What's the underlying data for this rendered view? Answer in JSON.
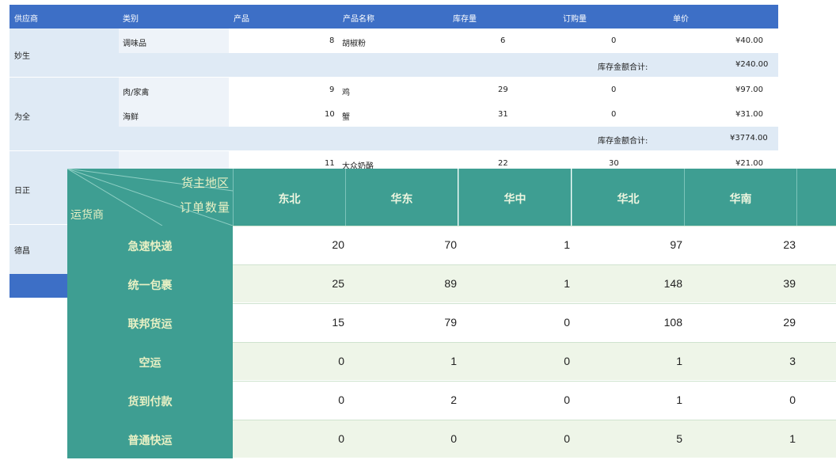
{
  "back_table": {
    "headers": [
      "供应商",
      "类别",
      "产品",
      "产品名称",
      "库存量",
      "订购量",
      "单价"
    ],
    "suppliers": [
      "妙生",
      "为全",
      "日正",
      "德昌"
    ],
    "rows": [
      {
        "category": "调味品",
        "product_id": "8",
        "name": "胡椒粉",
        "stock": "6",
        "order": "0",
        "price": "¥40.00"
      },
      {
        "category": "肉/家禽",
        "product_id": "9",
        "name": "鸡",
        "stock": "29",
        "order": "0",
        "price": "¥97.00"
      },
      {
        "category": "海鲜",
        "product_id": "10",
        "name": "蟹",
        "stock": "31",
        "order": "0",
        "price": "¥31.00"
      },
      {
        "category": "",
        "product_id": "11",
        "name": "大众奶酪",
        "stock": "22",
        "order": "30",
        "price": "¥21.00"
      }
    ],
    "subtotals": [
      {
        "label": "库存金额合计:",
        "value": "¥240.00"
      },
      {
        "label": "库存金额合计:",
        "value": "¥3774.00"
      }
    ]
  },
  "front_table": {
    "corner": {
      "region_label": "货主地区",
      "orders_label": "订单数量",
      "carrier_label": "运货商"
    },
    "regions": [
      "东北",
      "华东",
      "华中",
      "华北",
      "华南"
    ],
    "rows": [
      {
        "carrier": "急速快递",
        "values": [
          "20",
          "70",
          "1",
          "97",
          "23"
        ]
      },
      {
        "carrier": "统一包裹",
        "values": [
          "25",
          "89",
          "1",
          "148",
          "39"
        ]
      },
      {
        "carrier": "联邦货运",
        "values": [
          "15",
          "79",
          "0",
          "108",
          "29"
        ]
      },
      {
        "carrier": "空运",
        "values": [
          "0",
          "1",
          "0",
          "1",
          "3"
        ]
      },
      {
        "carrier": "货到付款",
        "values": [
          "0",
          "2",
          "0",
          "1",
          "0"
        ]
      },
      {
        "carrier": "普通快运",
        "values": [
          "0",
          "0",
          "0",
          "5",
          "1"
        ]
      }
    ]
  }
}
